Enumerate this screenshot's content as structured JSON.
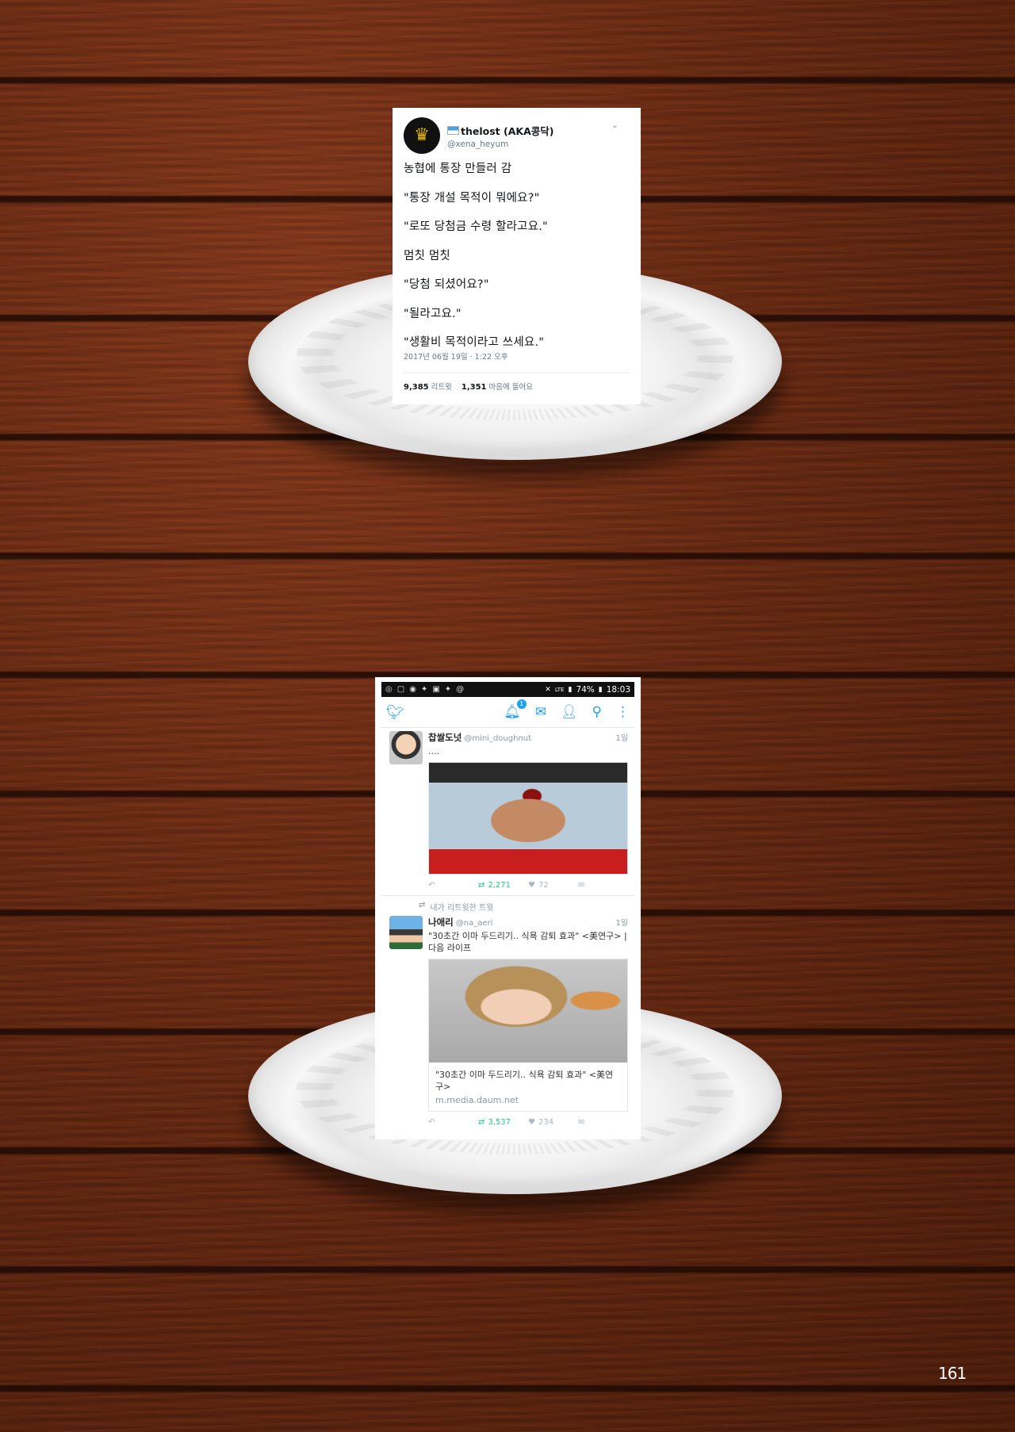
{
  "tweet_card": {
    "display_name": "thelost (AKA콩닥)",
    "handle": "@xena_heyum",
    "lines": [
      "농협에 통장 만들러 감",
      "\"통장 개설 목적이 뭐에요?\"",
      "\"로또 당첨금 수령 할라고요.\"",
      "멈칫 멈칫",
      "\"당첨 되셨어요?\"",
      "\"될라고요.\"",
      "\"생활비 목적이라고 쓰세요.\""
    ],
    "date": "2017년 06월 19일 · 1:22 오후",
    "retweets_count": "9,385",
    "retweets_label": "리트윗",
    "likes_count": "1,351",
    "likes_label": "마음에 들어요",
    "icons": {
      "avatar": "crown-logo-icon",
      "menu": "chevron-down-icon"
    }
  },
  "phone": {
    "status_bar": {
      "battery": "74%",
      "time": "18:03",
      "network": "LTE"
    },
    "app_bar": {
      "notification_badge": "1",
      "accent_color": "#1da1f2"
    },
    "tweets": [
      {
        "name": "찹쌀도넛",
        "handle": "@mini_doughnut",
        "time": "1일",
        "text": "....",
        "retweets": "2,271",
        "likes": "72"
      },
      {
        "retweeted_label": "내가 리트윗한 트윗",
        "name": "나애리",
        "handle": "@na_aeri",
        "time": "1일",
        "text": "\"30초간 이마 두드리기.. 식욕 감퇴 효과\" <美연구> | 다음 라이프",
        "card_title": "\"30초간 이마 두드리기.. 식욕 감퇴 효과\" <美연구>",
        "card_url": "m.media.daum.net",
        "retweets": "3,537",
        "likes": "234"
      }
    ]
  },
  "page_number": "161"
}
